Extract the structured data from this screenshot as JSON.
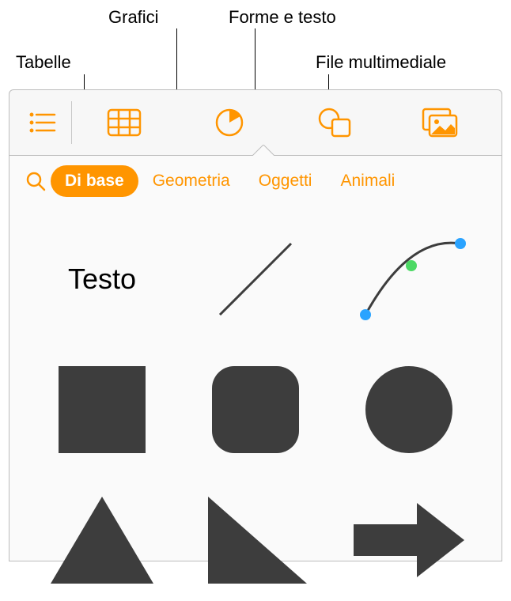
{
  "callouts": {
    "tabelle": "Tabelle",
    "grafici": "Grafici",
    "forme_testo": "Forme e testo",
    "file_multimediale": "File multimediale"
  },
  "toolbar": {
    "toc": "table-of-contents",
    "tables": "tables",
    "charts": "charts",
    "shapes": "shapes",
    "media": "media"
  },
  "categories": {
    "basic": "Di base",
    "geometry": "Geometria",
    "objects": "Oggetti",
    "animals": "Animali"
  },
  "shapes": {
    "text_label": "Testo"
  },
  "colors": {
    "accent": "#ff9500",
    "shape_fill": "#3d3d3d",
    "icon_stroke": "#ff9500"
  }
}
